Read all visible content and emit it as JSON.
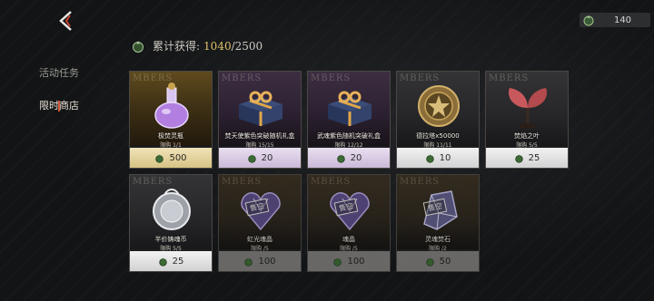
{
  "header": {
    "currency_value": "140",
    "progress_label": "累计获得:",
    "progress_current": "1040",
    "progress_sep": "/2500"
  },
  "sidebar": {
    "items": [
      {
        "label": "活动任务",
        "active": false
      },
      {
        "label": "限时商店",
        "active": true
      }
    ]
  },
  "shop": {
    "brand": "MBERS",
    "items": [
      {
        "name": "极焚灵瓶",
        "limit": "限购 1/1",
        "price": "500",
        "tier": "gold",
        "icon": "potion-bottle-icon"
      },
      {
        "name": "焚天使紫色突破随机礼盒",
        "limit": "限购 15/15",
        "price": "20",
        "tier": "purple",
        "icon": "gift-box-icon"
      },
      {
        "name": "武魂紫色随机突破礼盒",
        "limit": "限购 12/12",
        "price": "20",
        "tier": "purple",
        "icon": "gift-box-icon"
      },
      {
        "name": "德拉塔x50000",
        "limit": "限购 11/11",
        "price": "10",
        "tier": "gray",
        "icon": "gold-coin-icon"
      },
      {
        "name": "焚焰之叶",
        "limit": "限购 5/5",
        "price": "25",
        "tier": "gray",
        "icon": "red-leaf-icon"
      },
      {
        "name": "半价铸魂币",
        "limit": "限购 5/5",
        "price": "25",
        "tier": "gray",
        "icon": "silver-coin-icon"
      },
      {
        "name": "虹光魂晶",
        "limit": "限购 /5",
        "price": "100",
        "tier": "dim",
        "icon": "heart-crystal-icon",
        "stamp": "售空"
      },
      {
        "name": "魂晶",
        "limit": "限购 /5",
        "price": "100",
        "tier": "dim",
        "icon": "heart-crystal-icon",
        "stamp": "售空"
      },
      {
        "name": "灵魂焚石",
        "limit": "限购 /2",
        "price": "50",
        "tier": "dim",
        "icon": "crystal-stone-icon",
        "stamp": "售空"
      }
    ]
  }
}
